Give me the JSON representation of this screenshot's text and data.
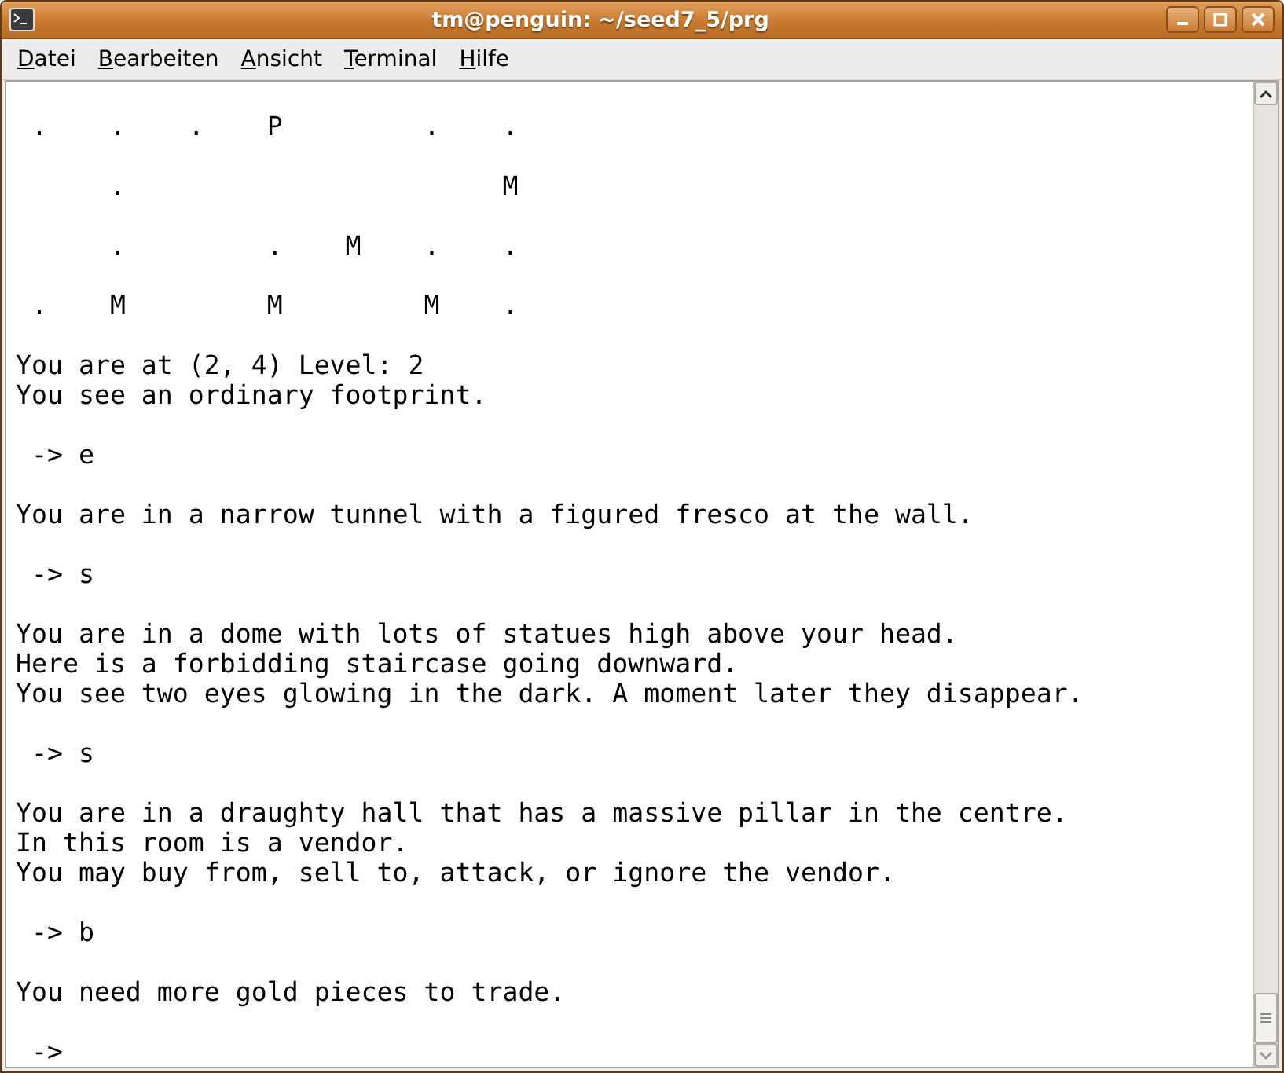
{
  "window": {
    "title": "tm@penguin: ~/seed7_5/prg"
  },
  "menu": [
    {
      "mnemonic": "D",
      "rest": "atei"
    },
    {
      "mnemonic": "B",
      "rest": "earbeiten"
    },
    {
      "mnemonic": "A",
      "rest": "nsicht"
    },
    {
      "mnemonic": "T",
      "rest": "erminal"
    },
    {
      "mnemonic": "H",
      "rest": "ilfe"
    }
  ],
  "terminal": {
    "lines": [
      {
        "kind": "map",
        "text": " .    .    .    P         .    ."
      },
      {
        "kind": "map",
        "text": "      .                        M"
      },
      {
        "kind": "map",
        "text": "      .         .    M    .    ."
      },
      {
        "kind": "map",
        "text": " .    M         M         M    ."
      },
      {
        "kind": "output",
        "text": "You are at (2, 4) Level: 2"
      },
      {
        "kind": "output",
        "text": "You see an ordinary footprint."
      },
      {
        "kind": "prompt",
        "text": " -> e"
      },
      {
        "kind": "output",
        "text": "You are in a narrow tunnel with a figured fresco at the wall."
      },
      {
        "kind": "prompt",
        "text": " -> s"
      },
      {
        "kind": "output",
        "text": "You are in a dome with lots of statues high above your head."
      },
      {
        "kind": "output",
        "text": "Here is a forbidding staircase going downward."
      },
      {
        "kind": "output",
        "text": "You see two eyes glowing in the dark. A moment later they disappear."
      },
      {
        "kind": "prompt",
        "text": " -> s"
      },
      {
        "kind": "output",
        "text": "You are in a draughty hall that has a massive pillar in the centre."
      },
      {
        "kind": "output",
        "text": "In this room is a vendor."
      },
      {
        "kind": "output",
        "text": "You may buy from, sell to, attack, or ignore the vendor."
      },
      {
        "kind": "prompt",
        "text": " -> b"
      },
      {
        "kind": "output",
        "text": "You need more gold pieces to trade."
      },
      {
        "kind": "prompt",
        "text": " ->"
      }
    ]
  }
}
